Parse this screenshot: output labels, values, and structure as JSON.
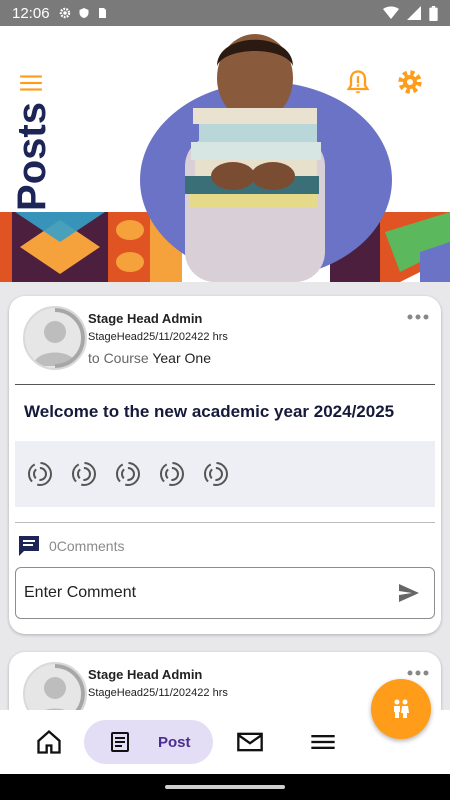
{
  "status_bar": {
    "time": "12:06"
  },
  "header": {
    "title": "Posts"
  },
  "posts": [
    {
      "author": "Stage Head Admin",
      "meta": "StageHead25/11/202422 hrs",
      "course_prefix": "to Course",
      "course_name": "Year One",
      "title": "Welcome to the new academic year 2024/2025",
      "comments_count": "0Comments",
      "comment_placeholder": "Enter Comment"
    },
    {
      "author": "Stage Head Admin",
      "meta": "StageHead25/11/202422 hrs"
    }
  ],
  "bottom_nav": {
    "post_label": "Post"
  },
  "colors": {
    "accent": "#ff9d1a",
    "title": "#1d2457",
    "nav_active": "#e3ddf5"
  }
}
